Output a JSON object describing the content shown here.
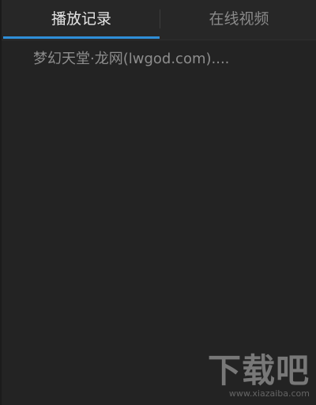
{
  "tabs": [
    {
      "label": "播放记录",
      "active": true
    },
    {
      "label": "在线视频",
      "active": false
    }
  ],
  "history": {
    "items": [
      {
        "title": "梦幻天堂·龙网(lwgod.com)...."
      }
    ]
  },
  "watermark": {
    "logo_text": "下载吧",
    "url": "www.xiazaiba.com"
  },
  "colors": {
    "background": "#232323",
    "accent": "#2f8fd8",
    "active_text": "#e6e6e6",
    "inactive_text": "#8a8a8a"
  }
}
